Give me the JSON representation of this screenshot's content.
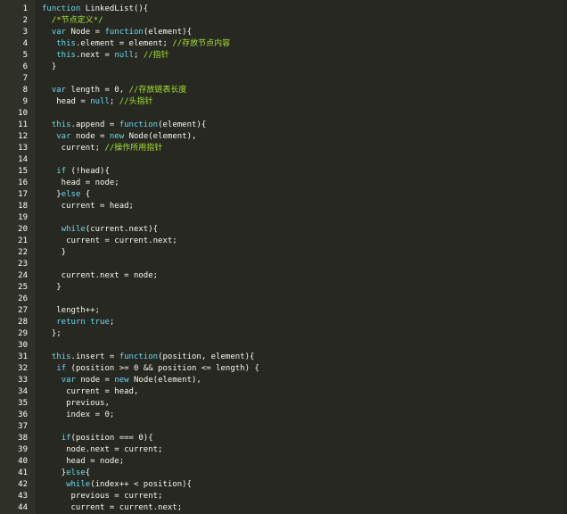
{
  "editor": {
    "lines": [
      {
        "n": "1",
        "tokens": [
          {
            "t": "function",
            "c": "k"
          },
          {
            "t": " LinkedList(){",
            "c": "p"
          }
        ]
      },
      {
        "n": "2",
        "tokens": [
          {
            "t": "  /*节点定义*/",
            "c": "c"
          }
        ]
      },
      {
        "n": "3",
        "tokens": [
          {
            "t": "  ",
            "c": "p"
          },
          {
            "t": "var",
            "c": "k"
          },
          {
            "t": " Node = ",
            "c": "p"
          },
          {
            "t": "function",
            "c": "k"
          },
          {
            "t": "(element){",
            "c": "p"
          }
        ]
      },
      {
        "n": "4",
        "tokens": [
          {
            "t": "   ",
            "c": "p"
          },
          {
            "t": "this",
            "c": "k"
          },
          {
            "t": ".element = element; ",
            "c": "p"
          },
          {
            "t": "//存放节点内容",
            "c": "c"
          }
        ]
      },
      {
        "n": "5",
        "tokens": [
          {
            "t": "   ",
            "c": "p"
          },
          {
            "t": "this",
            "c": "k"
          },
          {
            "t": ".next = ",
            "c": "p"
          },
          {
            "t": "null",
            "c": "k"
          },
          {
            "t": "; ",
            "c": "p"
          },
          {
            "t": "//指针",
            "c": "c"
          }
        ]
      },
      {
        "n": "6",
        "tokens": [
          {
            "t": "  }",
            "c": "p"
          }
        ]
      },
      {
        "n": "7",
        "tokens": []
      },
      {
        "n": "8",
        "tokens": [
          {
            "t": "  ",
            "c": "p"
          },
          {
            "t": "var",
            "c": "k"
          },
          {
            "t": " length = 0, ",
            "c": "p"
          },
          {
            "t": "//存放链表长度",
            "c": "c"
          }
        ]
      },
      {
        "n": "9",
        "tokens": [
          {
            "t": "   head = ",
            "c": "p"
          },
          {
            "t": "null",
            "c": "k"
          },
          {
            "t": "; ",
            "c": "p"
          },
          {
            "t": "//头指针",
            "c": "c"
          }
        ]
      },
      {
        "n": "10",
        "tokens": []
      },
      {
        "n": "11",
        "tokens": [
          {
            "t": "  ",
            "c": "p"
          },
          {
            "t": "this",
            "c": "k"
          },
          {
            "t": ".append = ",
            "c": "p"
          },
          {
            "t": "function",
            "c": "k"
          },
          {
            "t": "(element){",
            "c": "p"
          }
        ]
      },
      {
        "n": "12",
        "tokens": [
          {
            "t": "   ",
            "c": "p"
          },
          {
            "t": "var",
            "c": "k"
          },
          {
            "t": " node = ",
            "c": "p"
          },
          {
            "t": "new",
            "c": "k"
          },
          {
            "t": " Node(element),",
            "c": "p"
          }
        ]
      },
      {
        "n": "13",
        "tokens": [
          {
            "t": "    current; ",
            "c": "p"
          },
          {
            "t": "//操作所用指针",
            "c": "c"
          }
        ]
      },
      {
        "n": "14",
        "tokens": []
      },
      {
        "n": "15",
        "tokens": [
          {
            "t": "   ",
            "c": "p"
          },
          {
            "t": "if",
            "c": "k"
          },
          {
            "t": " (!head){",
            "c": "p"
          }
        ]
      },
      {
        "n": "16",
        "tokens": [
          {
            "t": "    head = node;",
            "c": "p"
          }
        ]
      },
      {
        "n": "17",
        "tokens": [
          {
            "t": "   }",
            "c": "p"
          },
          {
            "t": "else",
            "c": "k"
          },
          {
            "t": " {",
            "c": "p"
          }
        ]
      },
      {
        "n": "18",
        "tokens": [
          {
            "t": "    current = head;",
            "c": "p"
          }
        ]
      },
      {
        "n": "19",
        "tokens": []
      },
      {
        "n": "20",
        "tokens": [
          {
            "t": "    ",
            "c": "p"
          },
          {
            "t": "while",
            "c": "k"
          },
          {
            "t": "(current.next){",
            "c": "p"
          }
        ]
      },
      {
        "n": "21",
        "tokens": [
          {
            "t": "     current = current.next;",
            "c": "p"
          }
        ]
      },
      {
        "n": "22",
        "tokens": [
          {
            "t": "    }",
            "c": "p"
          }
        ]
      },
      {
        "n": "23",
        "tokens": []
      },
      {
        "n": "24",
        "tokens": [
          {
            "t": "    current.next = node;",
            "c": "p"
          }
        ]
      },
      {
        "n": "25",
        "tokens": [
          {
            "t": "   }",
            "c": "p"
          }
        ]
      },
      {
        "n": "26",
        "tokens": []
      },
      {
        "n": "27",
        "tokens": [
          {
            "t": "   length++;",
            "c": "p"
          }
        ]
      },
      {
        "n": "28",
        "tokens": [
          {
            "t": "   ",
            "c": "p"
          },
          {
            "t": "return",
            "c": "k"
          },
          {
            "t": " ",
            "c": "p"
          },
          {
            "t": "true",
            "c": "k"
          },
          {
            "t": ";",
            "c": "p"
          }
        ]
      },
      {
        "n": "29",
        "tokens": [
          {
            "t": "  };",
            "c": "p"
          }
        ]
      },
      {
        "n": "30",
        "tokens": []
      },
      {
        "n": "31",
        "tokens": [
          {
            "t": "  ",
            "c": "p"
          },
          {
            "t": "this",
            "c": "k"
          },
          {
            "t": ".insert = ",
            "c": "p"
          },
          {
            "t": "function",
            "c": "k"
          },
          {
            "t": "(position, element){",
            "c": "p"
          }
        ]
      },
      {
        "n": "32",
        "tokens": [
          {
            "t": "   ",
            "c": "p"
          },
          {
            "t": "if",
            "c": "k"
          },
          {
            "t": " (position >= 0 && position <= length) {",
            "c": "p"
          }
        ]
      },
      {
        "n": "33",
        "tokens": [
          {
            "t": "    ",
            "c": "p"
          },
          {
            "t": "var",
            "c": "k"
          },
          {
            "t": " node = ",
            "c": "p"
          },
          {
            "t": "new",
            "c": "k"
          },
          {
            "t": " Node(element),",
            "c": "p"
          }
        ]
      },
      {
        "n": "34",
        "tokens": [
          {
            "t": "     current = head,",
            "c": "p"
          }
        ]
      },
      {
        "n": "35",
        "tokens": [
          {
            "t": "     previous,",
            "c": "p"
          }
        ]
      },
      {
        "n": "36",
        "tokens": [
          {
            "t": "     index = 0;",
            "c": "p"
          }
        ]
      },
      {
        "n": "37",
        "tokens": []
      },
      {
        "n": "38",
        "tokens": [
          {
            "t": "    ",
            "c": "p"
          },
          {
            "t": "if",
            "c": "k"
          },
          {
            "t": "(position === 0){",
            "c": "p"
          }
        ]
      },
      {
        "n": "39",
        "tokens": [
          {
            "t": "     node.next = current;",
            "c": "p"
          }
        ]
      },
      {
        "n": "40",
        "tokens": [
          {
            "t": "     head = node;",
            "c": "p"
          }
        ]
      },
      {
        "n": "41",
        "tokens": [
          {
            "t": "    }",
            "c": "p"
          },
          {
            "t": "else",
            "c": "k"
          },
          {
            "t": "{",
            "c": "p"
          }
        ]
      },
      {
        "n": "42",
        "tokens": [
          {
            "t": "     ",
            "c": "p"
          },
          {
            "t": "while",
            "c": "k"
          },
          {
            "t": "(index++ < position){",
            "c": "p"
          }
        ]
      },
      {
        "n": "43",
        "tokens": [
          {
            "t": "      previous = current;",
            "c": "p"
          }
        ]
      },
      {
        "n": "44",
        "tokens": [
          {
            "t": "      current = current.next;",
            "c": "p"
          }
        ]
      }
    ]
  }
}
